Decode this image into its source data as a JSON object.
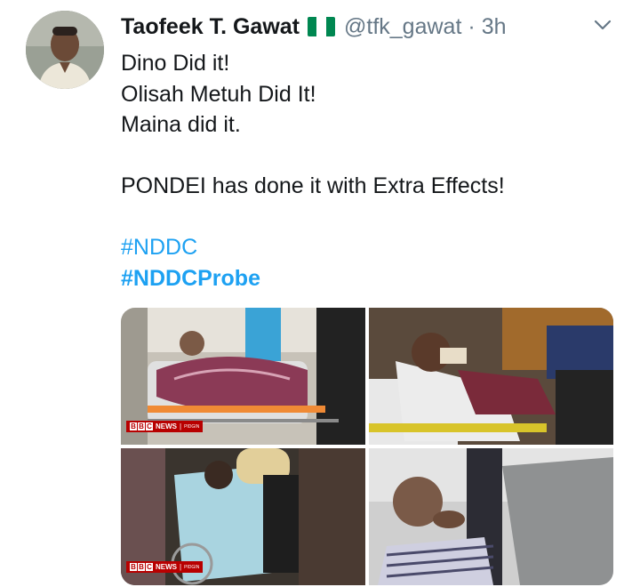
{
  "tweet": {
    "author_name": "Taofeek T. Gawat",
    "handle": "@tfk_gawat",
    "separator": "·",
    "time": "3h",
    "flag_colors": [
      "#008751",
      "#ffffff",
      "#008751"
    ],
    "lines": [
      "Dino Did it!",
      "Olisah Metuh Did It!",
      "Maina did it.",
      "",
      "PONDEI has done it with Extra Effects!",
      ""
    ],
    "hashtags": [
      "#NDDC",
      "#NDDCProbe"
    ]
  },
  "media": {
    "badge_letters": [
      "B",
      "B",
      "C"
    ],
    "badge_news": "NEWS",
    "badge_sep": "|",
    "badge_sub": "PIDGIN"
  },
  "colors": {
    "link": "#1da1f2",
    "muted": "#657786",
    "text": "#14171a",
    "bbc_red": "#b80000"
  },
  "icons": {
    "menu": "chevron-down-icon",
    "flag": "nigeria-flag-icon"
  }
}
